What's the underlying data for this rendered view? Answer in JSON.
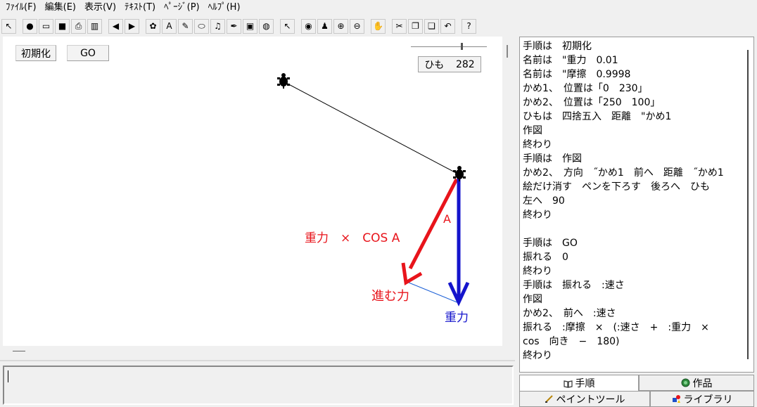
{
  "menu": {
    "items": [
      "ﾌｧｲﾙ(F)",
      "編集(E)",
      "表示(V)",
      "ﾃｷｽﾄ(T)",
      "ﾍﾟｰｼﾞ(P)",
      "ﾍﾙﾌﾟ(H)"
    ]
  },
  "toolbar": {
    "icons": [
      "cursor-icon",
      "globe-icon",
      "open-folder-icon",
      "save-icon",
      "print-icon",
      "columns-icon",
      "left-arrow-icon",
      "right-arrow-icon",
      "turtle-icon",
      "text-box-icon",
      "pen-icon",
      "capsule-icon",
      "music-icon",
      "brush-icon",
      "movie-icon",
      "earth-icon",
      "pointer-icon",
      "eye-icon",
      "stamp-icon",
      "zoom-in-icon",
      "zoom-out-icon",
      "stop-hand-icon",
      "cut-icon",
      "copy-icon",
      "paste-icon",
      "undo-icon",
      "help-icon"
    ],
    "glyphs": [
      "↖",
      "●",
      "▭",
      "■",
      "⎙",
      "▥",
      "◀",
      "▶",
      "✿",
      "A",
      "✎",
      "⬭",
      "♫",
      "✒",
      "▣",
      "◍",
      "↖",
      "◉",
      "♟",
      "⊕",
      "⊖",
      "✋",
      "✂",
      "❐",
      "❏",
      "↶",
      "?"
    ]
  },
  "canvas": {
    "init_button": "初期化",
    "go_button": "GO",
    "string_label": "ひも",
    "string_value": "282",
    "slider_value": 0.68,
    "labels": {
      "angle": "A",
      "force_component": "重力　×　COS A",
      "moving_force": "進む力",
      "gravity": "重力"
    },
    "colors": {
      "red": "#e8141b",
      "blue": "#1414cc",
      "thin_blue": "#1a5fd6"
    }
  },
  "script_lines": [
    "手順は　初期化",
    "名前は　\"重力　0.01",
    "名前は　\"摩擦　0.9998",
    "かめ1、　位置は「0　230」",
    "かめ2、　位置は「250　100」",
    "ひもは　四捨五入　距離　\"かめ1",
    "作図",
    "終わり",
    "手順は　作図",
    "かめ2、　方向　˝かめ1　前へ　距離　˝かめ1",
    "絵だけ消す　ペンを下ろす　後ろへ　ひも",
    "左へ　90",
    "終わり",
    "",
    "手順は　GO",
    "振れる　0",
    "終わり",
    "手順は　振れる　:速さ",
    "作図",
    "かめ2、　前へ　:速さ",
    "振れる　:摩擦　×　(:速さ　+　:重力　×",
    "cos　向き　−　180)",
    "終わり"
  ],
  "tabs": {
    "procedure": "手順",
    "work": "作品",
    "paint_tool": "ペイントツール",
    "library": "ライブラリ"
  }
}
